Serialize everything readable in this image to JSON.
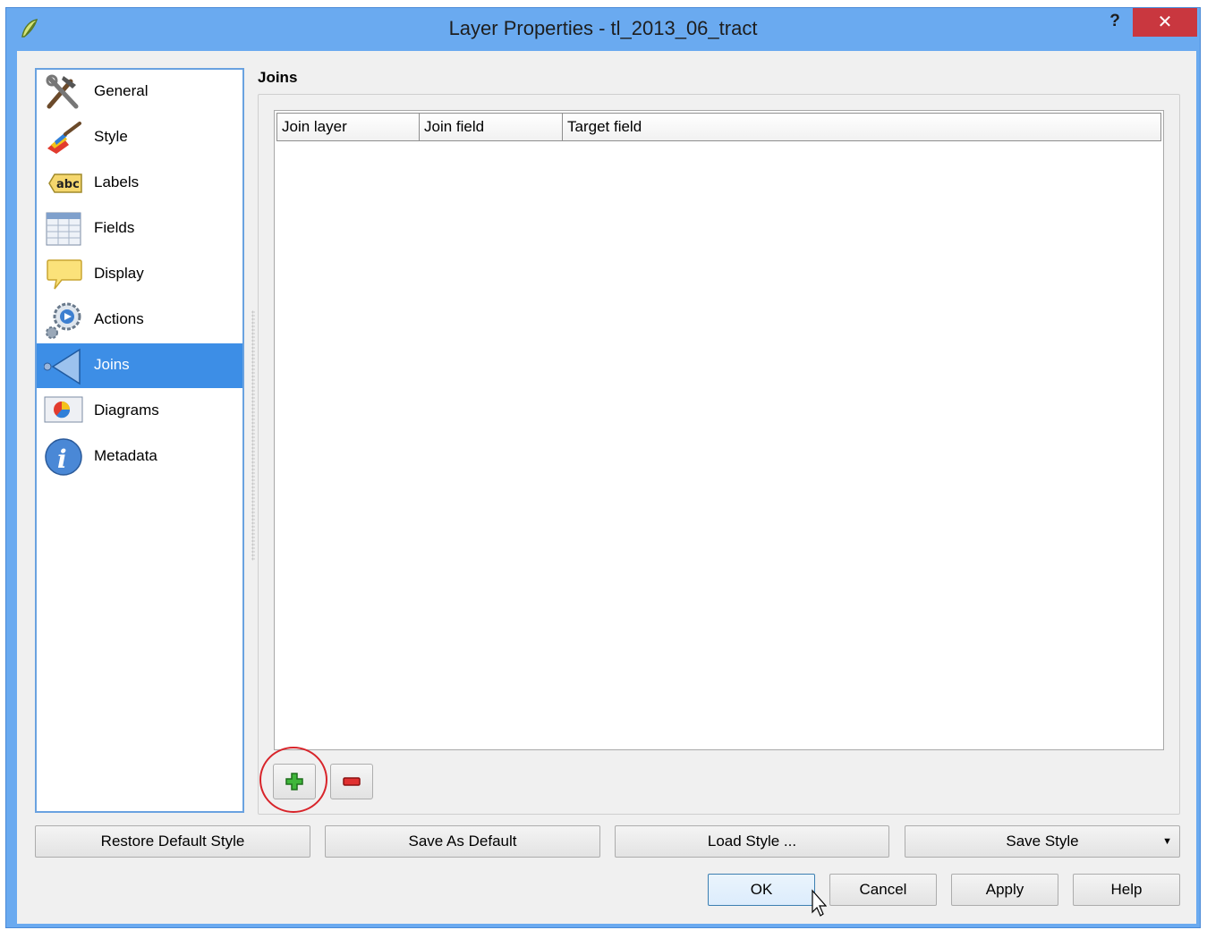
{
  "window": {
    "title": "Layer Properties - tl_2013_06_tract",
    "help_label": "?",
    "close_label": "✕"
  },
  "sidebar": {
    "items": [
      {
        "label": "General",
        "icon": "hammer-wrench-icon"
      },
      {
        "label": "Style",
        "icon": "paintbrush-icon"
      },
      {
        "label": "Labels",
        "icon": "abc-label-icon"
      },
      {
        "label": "Fields",
        "icon": "table-fields-icon"
      },
      {
        "label": "Display",
        "icon": "speech-bubble-icon"
      },
      {
        "label": "Actions",
        "icon": "gear-play-icon"
      },
      {
        "label": "Joins",
        "icon": "join-arrow-icon",
        "selected": true
      },
      {
        "label": "Diagrams",
        "icon": "pie-diagram-icon"
      },
      {
        "label": "Metadata",
        "icon": "info-icon"
      }
    ]
  },
  "main": {
    "section_title": "Joins",
    "table": {
      "columns": [
        "Join layer",
        "Join field",
        "Target field"
      ],
      "rows": []
    },
    "add_icon": "add-join-icon",
    "remove_icon": "remove-join-icon"
  },
  "style_buttons": {
    "restore": "Restore Default Style",
    "save_default": "Save As Default",
    "load": "Load Style ...",
    "save": "Save Style"
  },
  "dialog_buttons": {
    "ok": "OK",
    "cancel": "Cancel",
    "apply": "Apply",
    "help": "Help"
  },
  "colors": {
    "titlebar": "#6aaaf0",
    "selection": "#3d8ee6",
    "close": "#c9373f",
    "highlight_circle": "#d8242a"
  }
}
